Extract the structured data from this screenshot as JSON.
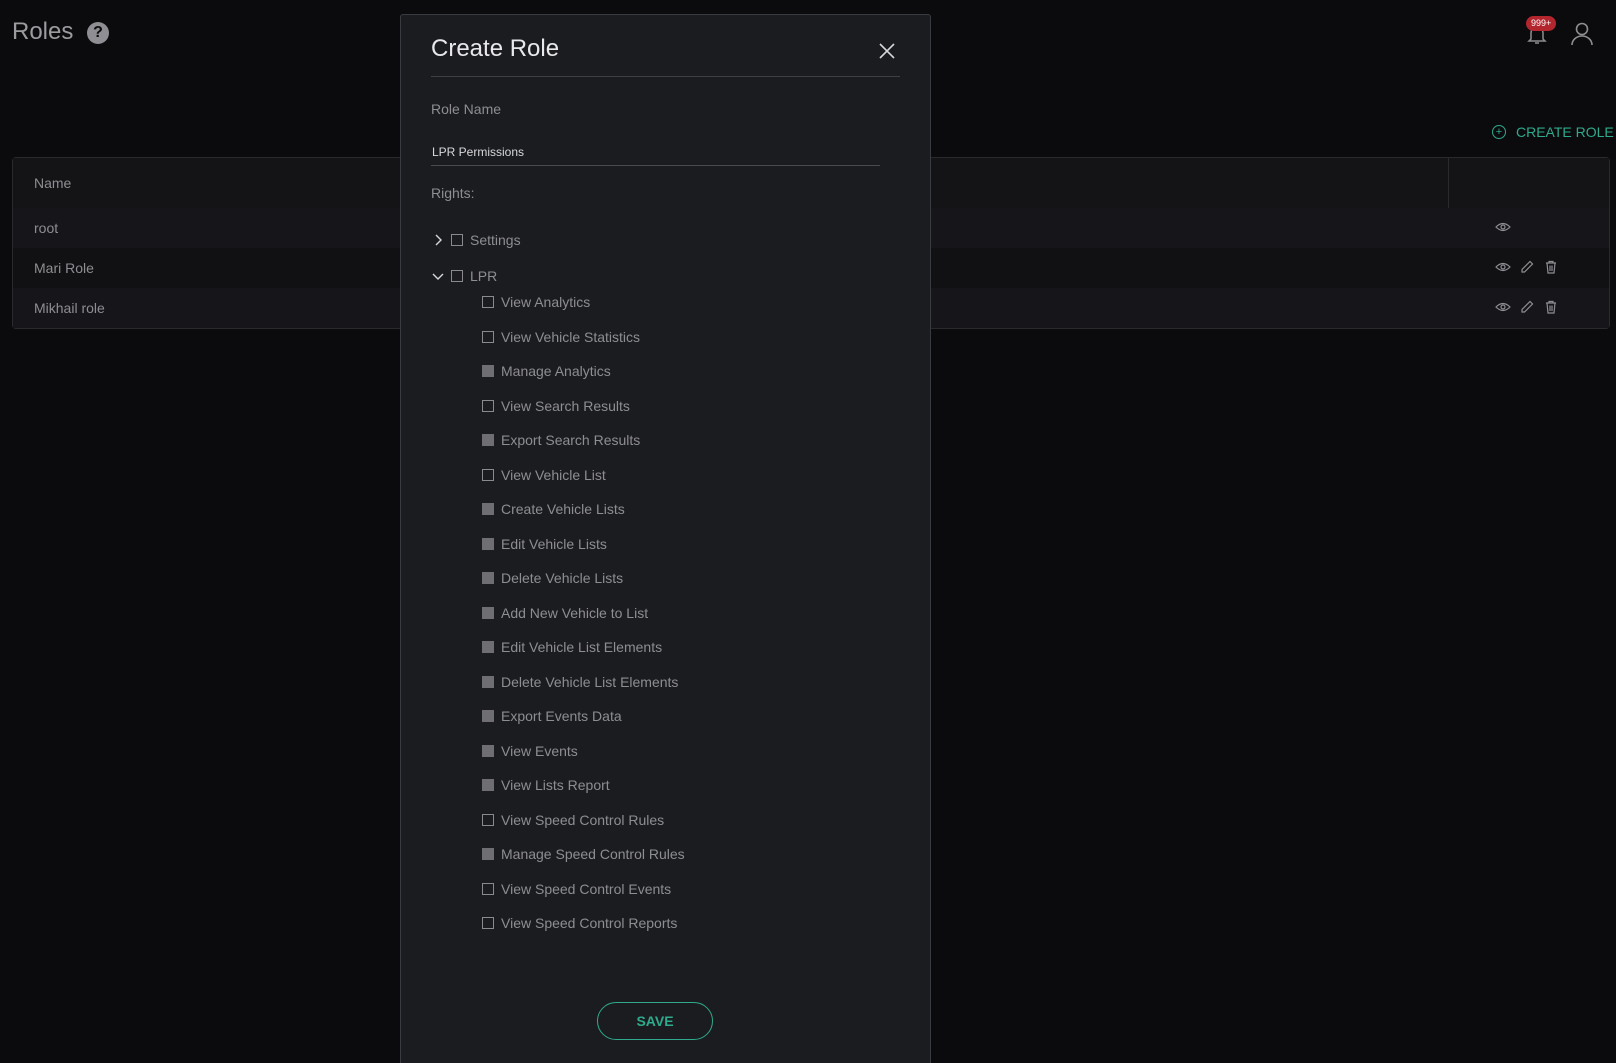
{
  "header": {
    "title": "Roles",
    "help_glyph": "?",
    "notification_count": "999+",
    "icons": [
      "help-icon",
      "bell-icon",
      "user-icon"
    ]
  },
  "toolbar": {
    "create_role_label": "CREATE ROLE"
  },
  "table": {
    "columns": [
      "Name"
    ],
    "rows": [
      {
        "name": "root",
        "actions": [
          "view"
        ]
      },
      {
        "name": "Mari Role",
        "actions": [
          "view",
          "edit",
          "delete"
        ]
      },
      {
        "name": "Mikhail role",
        "actions": [
          "view",
          "edit",
          "delete"
        ]
      }
    ]
  },
  "modal": {
    "title": "Create Role",
    "role_name_label": "Role Name",
    "role_name_value": "LPR Permissions",
    "rights_label": "Rights:",
    "groups": [
      {
        "label": "Settings",
        "expanded": false,
        "checked": false
      },
      {
        "label": "LPR",
        "expanded": true,
        "checked": false
      }
    ],
    "lpr_rights": [
      {
        "label": "View Analytics",
        "checked": false
      },
      {
        "label": "View Vehicle Statistics",
        "checked": false
      },
      {
        "label": "Manage Analytics",
        "checked": true
      },
      {
        "label": "View Search Results",
        "checked": false
      },
      {
        "label": "Export Search Results",
        "checked": true
      },
      {
        "label": "View Vehicle List",
        "checked": false
      },
      {
        "label": "Create Vehicle Lists",
        "checked": true
      },
      {
        "label": "Edit Vehicle Lists",
        "checked": true
      },
      {
        "label": "Delete Vehicle Lists",
        "checked": true
      },
      {
        "label": "Add New Vehicle to List",
        "checked": true
      },
      {
        "label": "Edit Vehicle List Elements",
        "checked": true
      },
      {
        "label": "Delete Vehicle List Elements",
        "checked": true
      },
      {
        "label": "Export Events Data",
        "checked": true
      },
      {
        "label": "View Events",
        "checked": true
      },
      {
        "label": "View Lists Report",
        "checked": true
      },
      {
        "label": "View Speed Control Rules",
        "checked": false
      },
      {
        "label": "Manage Speed Control Rules",
        "checked": true
      },
      {
        "label": "View Speed Control Events",
        "checked": false
      },
      {
        "label": "View Speed Control Reports",
        "checked": false
      }
    ],
    "save_label": "SAVE"
  },
  "colors": {
    "accent": "#2eaa8c",
    "badge": "#b3262e",
    "background": "#0b0b0d",
    "modal": "#1b1c20"
  }
}
